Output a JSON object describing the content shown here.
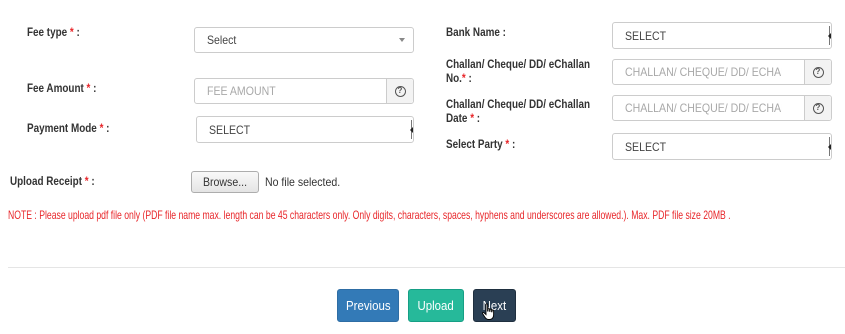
{
  "left": {
    "fee_type": {
      "label": "Fee type",
      "value": "Select"
    },
    "fee_amount": {
      "label": "Fee Amount",
      "placeholder": "FEE AMOUNT",
      "help": "?"
    },
    "payment_mode": {
      "label": "Payment Mode",
      "value": "SELECT"
    }
  },
  "right": {
    "bank_name": {
      "label": "Bank Name :",
      "value": "SELECT"
    },
    "challan_no": {
      "label_line1": "Challan/ Cheque/ DD/ eChallan",
      "label_line2": "No.",
      "placeholder": "CHALLAN/ CHEQUE/ DD/ ECHALLAN NO",
      "help": "?"
    },
    "challan_date": {
      "label_line1": "Challan/ Cheque/ DD/ eChallan",
      "label_line2": "Date",
      "placeholder": "CHALLAN/ CHEQUE/ DD/ ECHALLAN DATE",
      "help": "?"
    },
    "select_party": {
      "label": "Select Party",
      "value": "SELECT"
    }
  },
  "upload": {
    "label": "Upload Receipt",
    "browse": "Browse...",
    "status": "No file selected."
  },
  "required_mark": "*",
  "colon": ":",
  "note": "NOTE : Please upload pdf file only (PDF file name max. length can be 45 characters only. Only digits, characters, spaces, hyphens and underscores are allowed.). Max. PDF file size 20MB .",
  "buttons": {
    "previous": "Previous",
    "upload": "Upload",
    "next": "Next"
  },
  "colors": {
    "required": "#e8262a",
    "previous": "#337ab7",
    "upload": "#26b99a",
    "next": "#2a3f54"
  }
}
